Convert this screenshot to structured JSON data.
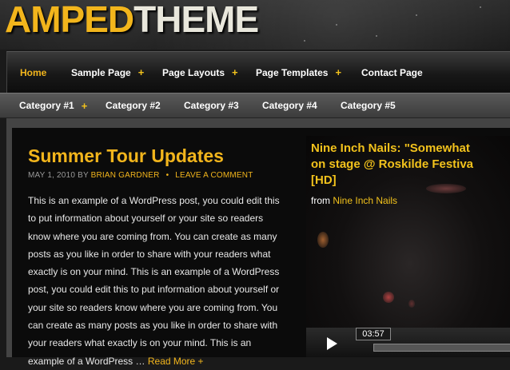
{
  "logo": {
    "part1": "AMPED",
    "part2": "THEME"
  },
  "nav": {
    "primary": [
      {
        "label": "Home",
        "active": true,
        "has_submenu": false
      },
      {
        "label": "Sample Page",
        "has_submenu": true
      },
      {
        "label": "Page Layouts",
        "has_submenu": true
      },
      {
        "label": "Page Templates",
        "has_submenu": true
      },
      {
        "label": "Contact Page",
        "has_submenu": false
      }
    ],
    "secondary": [
      {
        "label": "Category #1",
        "has_submenu": true
      },
      {
        "label": "Category #2",
        "has_submenu": false
      },
      {
        "label": "Category #3",
        "has_submenu": false
      },
      {
        "label": "Category #4",
        "has_submenu": false
      },
      {
        "label": "Category #5",
        "has_submenu": false
      }
    ],
    "submenu_marker": "+"
  },
  "post": {
    "title": "Summer Tour Updates",
    "date": "MAY 1, 2010",
    "by": "BY",
    "author": "BRIAN GARDNER",
    "separator": "•",
    "comment_link": "LEAVE A COMMENT",
    "excerpt": "This is an example of a WordPress post, you could edit this to put information about yourself or your site so readers know where you are coming from. You can create as many posts as you like in order to share with your readers what exactly is on your mind. This is an example of a WordPress post, you could edit this to put information about yourself or your site so readers know where you are coming from. You can create as many posts as you like in order to share with your readers what exactly is on your mind. This is an example of a WordPress …",
    "read_more": "Read More +"
  },
  "video": {
    "title_line1": "Nine Inch Nails: \"Somewhat",
    "title_line2": "on stage @ Roskilde Festiva",
    "title_line3": "[HD]",
    "from_label": "from",
    "from_link": "Nine Inch Nails",
    "time": "03:57",
    "icons": [
      "play-icon"
    ]
  },
  "colors": {
    "accent": "#f2b51c",
    "text": "#e8e8e8",
    "background": "#0b0b0b"
  }
}
